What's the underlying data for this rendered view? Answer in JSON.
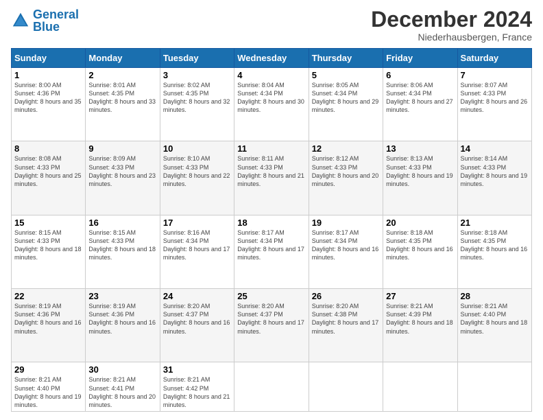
{
  "header": {
    "logo_general": "General",
    "logo_blue": "Blue",
    "month_year": "December 2024",
    "location": "Niederhausbergen, France"
  },
  "days_of_week": [
    "Sunday",
    "Monday",
    "Tuesday",
    "Wednesday",
    "Thursday",
    "Friday",
    "Saturday"
  ],
  "weeks": [
    [
      {
        "day": "1",
        "sunrise": "8:00 AM",
        "sunset": "4:36 PM",
        "daylight": "8 hours and 35 minutes."
      },
      {
        "day": "2",
        "sunrise": "8:01 AM",
        "sunset": "4:35 PM",
        "daylight": "8 hours and 33 minutes."
      },
      {
        "day": "3",
        "sunrise": "8:02 AM",
        "sunset": "4:35 PM",
        "daylight": "8 hours and 32 minutes."
      },
      {
        "day": "4",
        "sunrise": "8:04 AM",
        "sunset": "4:34 PM",
        "daylight": "8 hours and 30 minutes."
      },
      {
        "day": "5",
        "sunrise": "8:05 AM",
        "sunset": "4:34 PM",
        "daylight": "8 hours and 29 minutes."
      },
      {
        "day": "6",
        "sunrise": "8:06 AM",
        "sunset": "4:34 PM",
        "daylight": "8 hours and 27 minutes."
      },
      {
        "day": "7",
        "sunrise": "8:07 AM",
        "sunset": "4:33 PM",
        "daylight": "8 hours and 26 minutes."
      }
    ],
    [
      {
        "day": "8",
        "sunrise": "8:08 AM",
        "sunset": "4:33 PM",
        "daylight": "8 hours and 25 minutes."
      },
      {
        "day": "9",
        "sunrise": "8:09 AM",
        "sunset": "4:33 PM",
        "daylight": "8 hours and 23 minutes."
      },
      {
        "day": "10",
        "sunrise": "8:10 AM",
        "sunset": "4:33 PM",
        "daylight": "8 hours and 22 minutes."
      },
      {
        "day": "11",
        "sunrise": "8:11 AM",
        "sunset": "4:33 PM",
        "daylight": "8 hours and 21 minutes."
      },
      {
        "day": "12",
        "sunrise": "8:12 AM",
        "sunset": "4:33 PM",
        "daylight": "8 hours and 20 minutes."
      },
      {
        "day": "13",
        "sunrise": "8:13 AM",
        "sunset": "4:33 PM",
        "daylight": "8 hours and 19 minutes."
      },
      {
        "day": "14",
        "sunrise": "8:14 AM",
        "sunset": "4:33 PM",
        "daylight": "8 hours and 19 minutes."
      }
    ],
    [
      {
        "day": "15",
        "sunrise": "8:15 AM",
        "sunset": "4:33 PM",
        "daylight": "8 hours and 18 minutes."
      },
      {
        "day": "16",
        "sunrise": "8:15 AM",
        "sunset": "4:33 PM",
        "daylight": "8 hours and 18 minutes."
      },
      {
        "day": "17",
        "sunrise": "8:16 AM",
        "sunset": "4:34 PM",
        "daylight": "8 hours and 17 minutes."
      },
      {
        "day": "18",
        "sunrise": "8:17 AM",
        "sunset": "4:34 PM",
        "daylight": "8 hours and 17 minutes."
      },
      {
        "day": "19",
        "sunrise": "8:17 AM",
        "sunset": "4:34 PM",
        "daylight": "8 hours and 16 minutes."
      },
      {
        "day": "20",
        "sunrise": "8:18 AM",
        "sunset": "4:35 PM",
        "daylight": "8 hours and 16 minutes."
      },
      {
        "day": "21",
        "sunrise": "8:18 AM",
        "sunset": "4:35 PM",
        "daylight": "8 hours and 16 minutes."
      }
    ],
    [
      {
        "day": "22",
        "sunrise": "8:19 AM",
        "sunset": "4:36 PM",
        "daylight": "8 hours and 16 minutes."
      },
      {
        "day": "23",
        "sunrise": "8:19 AM",
        "sunset": "4:36 PM",
        "daylight": "8 hours and 16 minutes."
      },
      {
        "day": "24",
        "sunrise": "8:20 AM",
        "sunset": "4:37 PM",
        "daylight": "8 hours and 16 minutes."
      },
      {
        "day": "25",
        "sunrise": "8:20 AM",
        "sunset": "4:37 PM",
        "daylight": "8 hours and 17 minutes."
      },
      {
        "day": "26",
        "sunrise": "8:20 AM",
        "sunset": "4:38 PM",
        "daylight": "8 hours and 17 minutes."
      },
      {
        "day": "27",
        "sunrise": "8:21 AM",
        "sunset": "4:39 PM",
        "daylight": "8 hours and 18 minutes."
      },
      {
        "day": "28",
        "sunrise": "8:21 AM",
        "sunset": "4:40 PM",
        "daylight": "8 hours and 18 minutes."
      }
    ],
    [
      {
        "day": "29",
        "sunrise": "8:21 AM",
        "sunset": "4:40 PM",
        "daylight": "8 hours and 19 minutes."
      },
      {
        "day": "30",
        "sunrise": "8:21 AM",
        "sunset": "4:41 PM",
        "daylight": "8 hours and 20 minutes."
      },
      {
        "day": "31",
        "sunrise": "8:21 AM",
        "sunset": "4:42 PM",
        "daylight": "8 hours and 21 minutes."
      },
      null,
      null,
      null,
      null
    ]
  ]
}
